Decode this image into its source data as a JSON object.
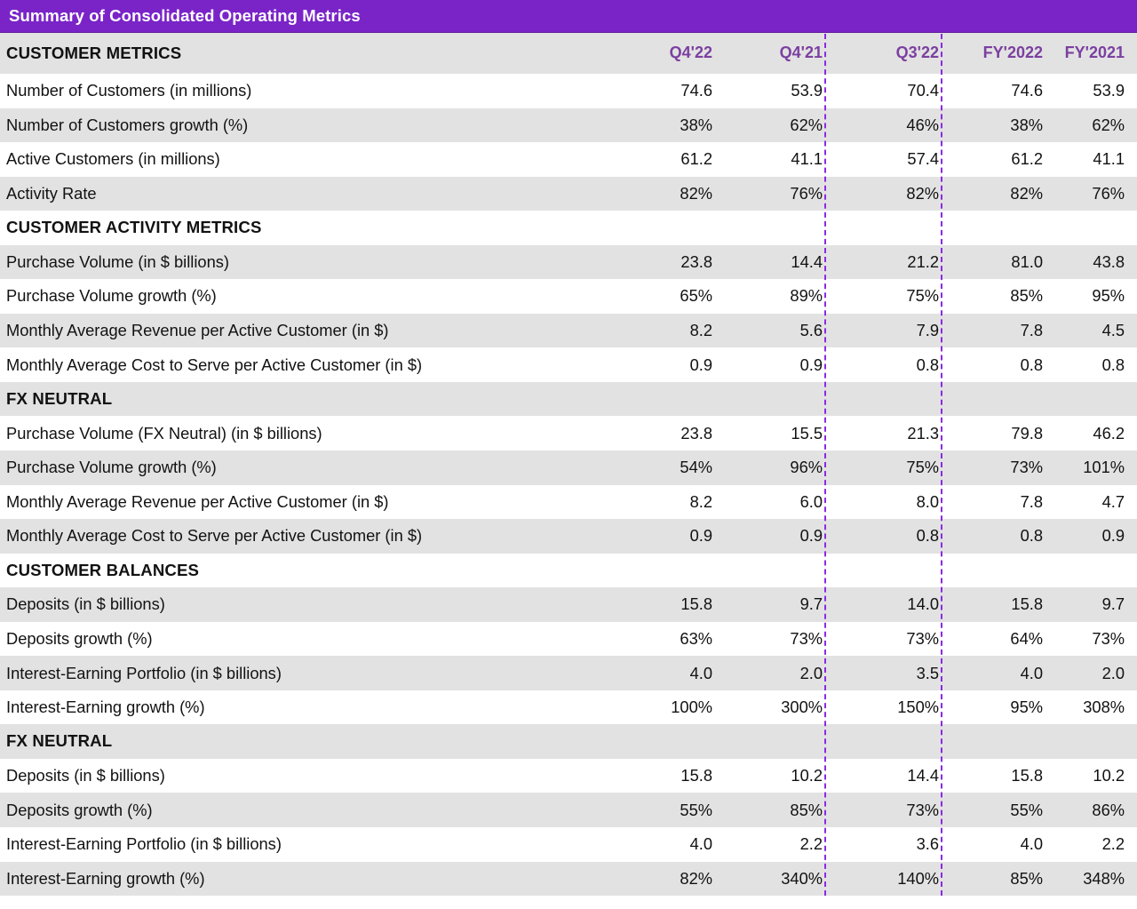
{
  "title": "Summary of Consolidated Operating Metrics",
  "theme": {
    "header_purple": "#7A24C8",
    "column_header_purple": "#7B3FA0",
    "stripe_gray": "#E2E2E2",
    "stripe_white": "#FFFFFF",
    "divider_purple": "#8A2BE2"
  },
  "columns": {
    "metric_header": "CUSTOMER METRICS",
    "q4_22": "Q4'22",
    "q4_21": "Q4'21",
    "q3_22": "Q3'22",
    "fy_2022": "FY'2022",
    "fy_2021": "FY'2021"
  },
  "chart_data": {
    "type": "table",
    "title": "Summary of Consolidated Operating Metrics",
    "columns": [
      "Metric",
      "Q4'22",
      "Q4'21",
      "Q3'22",
      "FY'2022",
      "FY'2021"
    ],
    "rows": [
      {
        "kind": "section",
        "label": "CUSTOMER METRICS",
        "values": [
          "",
          "",
          "",
          "",
          ""
        ]
      },
      {
        "kind": "data",
        "label": "Number of Customers (in millions)",
        "values": [
          "74.6",
          "53.9",
          "70.4",
          "74.6",
          "53.9"
        ]
      },
      {
        "kind": "data",
        "label": "Number of Customers growth (%)",
        "values": [
          "38%",
          "62%",
          "46%",
          "38%",
          "62%"
        ]
      },
      {
        "kind": "data",
        "label": "Active Customers (in millions)",
        "values": [
          "61.2",
          "41.1",
          "57.4",
          "61.2",
          "41.1"
        ]
      },
      {
        "kind": "data",
        "label": "Activity Rate",
        "values": [
          "82%",
          "76%",
          "82%",
          "82%",
          "76%"
        ]
      },
      {
        "kind": "section",
        "label": "CUSTOMER ACTIVITY METRICS",
        "values": [
          "",
          "",
          "",
          "",
          ""
        ]
      },
      {
        "kind": "data",
        "label": "Purchase Volume (in $ billions)",
        "values": [
          "23.8",
          "14.4",
          "21.2",
          "81.0",
          "43.8"
        ]
      },
      {
        "kind": "data",
        "label": "Purchase Volume growth (%)",
        "values": [
          "65%",
          "89%",
          "75%",
          "85%",
          "95%"
        ]
      },
      {
        "kind": "data",
        "label": "Monthly Average Revenue per Active Customer (in $)",
        "values": [
          "8.2",
          "5.6",
          "7.9",
          "7.8",
          "4.5"
        ]
      },
      {
        "kind": "data",
        "label": "Monthly Average Cost to Serve per Active Customer (in $)",
        "values": [
          "0.9",
          "0.9",
          "0.8",
          "0.8",
          "0.8"
        ]
      },
      {
        "kind": "section",
        "label": "FX NEUTRAL",
        "values": [
          "",
          "",
          "",
          "",
          ""
        ]
      },
      {
        "kind": "data",
        "label": "Purchase Volume (FX Neutral) (in $ billions)",
        "values": [
          "23.8",
          "15.5",
          "21.3",
          "79.8",
          "46.2"
        ]
      },
      {
        "kind": "data",
        "label": "Purchase Volume growth (%)",
        "values": [
          "54%",
          "96%",
          "75%",
          "73%",
          "101%"
        ]
      },
      {
        "kind": "data",
        "label": "Monthly Average Revenue per Active Customer (in $)",
        "values": [
          "8.2",
          "6.0",
          "8.0",
          "7.8",
          "4.7"
        ]
      },
      {
        "kind": "data",
        "label": "Monthly Average Cost to Serve per Active Customer (in $)",
        "values": [
          "0.9",
          "0.9",
          "0.8",
          "0.8",
          "0.9"
        ]
      },
      {
        "kind": "section",
        "label": "CUSTOMER BALANCES",
        "values": [
          "",
          "",
          "",
          "",
          ""
        ]
      },
      {
        "kind": "data",
        "label": "Deposits (in $ billions)",
        "values": [
          "15.8",
          "9.7",
          "14.0",
          "15.8",
          "9.7"
        ]
      },
      {
        "kind": "data",
        "label": "Deposits growth (%)",
        "values": [
          "63%",
          "73%",
          "73%",
          "64%",
          "73%"
        ]
      },
      {
        "kind": "data",
        "label": "Interest-Earning Portfolio (in $ billions)",
        "values": [
          "4.0",
          "2.0",
          "3.5",
          "4.0",
          "2.0"
        ]
      },
      {
        "kind": "data",
        "label": "Interest-Earning growth (%)",
        "values": [
          "100%",
          "300%",
          "150%",
          "95%",
          "308%"
        ]
      },
      {
        "kind": "section",
        "label": "FX NEUTRAL",
        "values": [
          "",
          "",
          "",
          "",
          ""
        ]
      },
      {
        "kind": "data",
        "label": "Deposits (in $ billions)",
        "values": [
          "15.8",
          "10.2",
          "14.4",
          "15.8",
          "10.2"
        ]
      },
      {
        "kind": "data",
        "label": "Deposits growth (%)",
        "values": [
          "55%",
          "85%",
          "73%",
          "55%",
          "86%"
        ]
      },
      {
        "kind": "data",
        "label": "Interest-Earning Portfolio (in $ billions)",
        "values": [
          "4.0",
          "2.2",
          "3.6",
          "4.0",
          "2.2"
        ]
      },
      {
        "kind": "data",
        "label": "Interest-Earning growth (%)",
        "values": [
          "82%",
          "340%",
          "140%",
          "85%",
          "348%"
        ]
      }
    ]
  }
}
